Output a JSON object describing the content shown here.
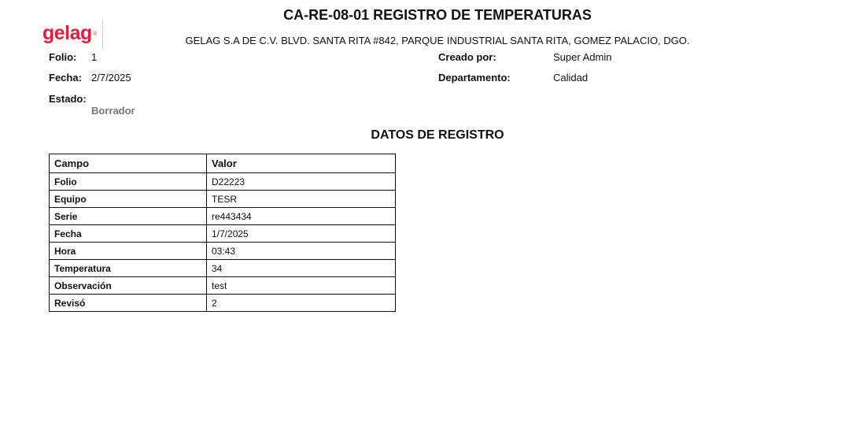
{
  "header": {
    "logo_text": "gelag",
    "logo_mark": "®",
    "title": "CA-RE-08-01 REGISTRO DE TEMPERATURAS",
    "company": "GELAG S.A DE C.V. BLVD. SANTA RITA #842, PARQUE INDUSTRIAL SANTA RITA, GOMEZ PALACIO, DGO."
  },
  "meta": {
    "folio_label": "Folio:",
    "folio_value": "1",
    "fecha_label": "Fecha:",
    "fecha_value": "2/7/2025",
    "estado_label": "Estado:",
    "estado_value": "Borrador",
    "creado_label": "Creado por:",
    "creado_value": "Super Admin",
    "depto_label": "Departamento:",
    "depto_value": "Calidad"
  },
  "section_title": "DATOS DE REGISTRO",
  "table": {
    "headers": [
      "Campo",
      "Valor"
    ],
    "rows": [
      {
        "campo": "Folio",
        "valor": "D22223"
      },
      {
        "campo": "Equipo",
        "valor": "TESR"
      },
      {
        "campo": "Serie",
        "valor": "re443434"
      },
      {
        "campo": "Fecha",
        "valor": "1/7/2025"
      },
      {
        "campo": "Hora",
        "valor": "03:43"
      },
      {
        "campo": "Temperatura",
        "valor": "34"
      },
      {
        "campo": "Observación",
        "valor": "test"
      },
      {
        "campo": "Revisó",
        "valor": "2"
      }
    ]
  },
  "colors": {
    "brand": "#e51b3e",
    "status": "#777777"
  }
}
